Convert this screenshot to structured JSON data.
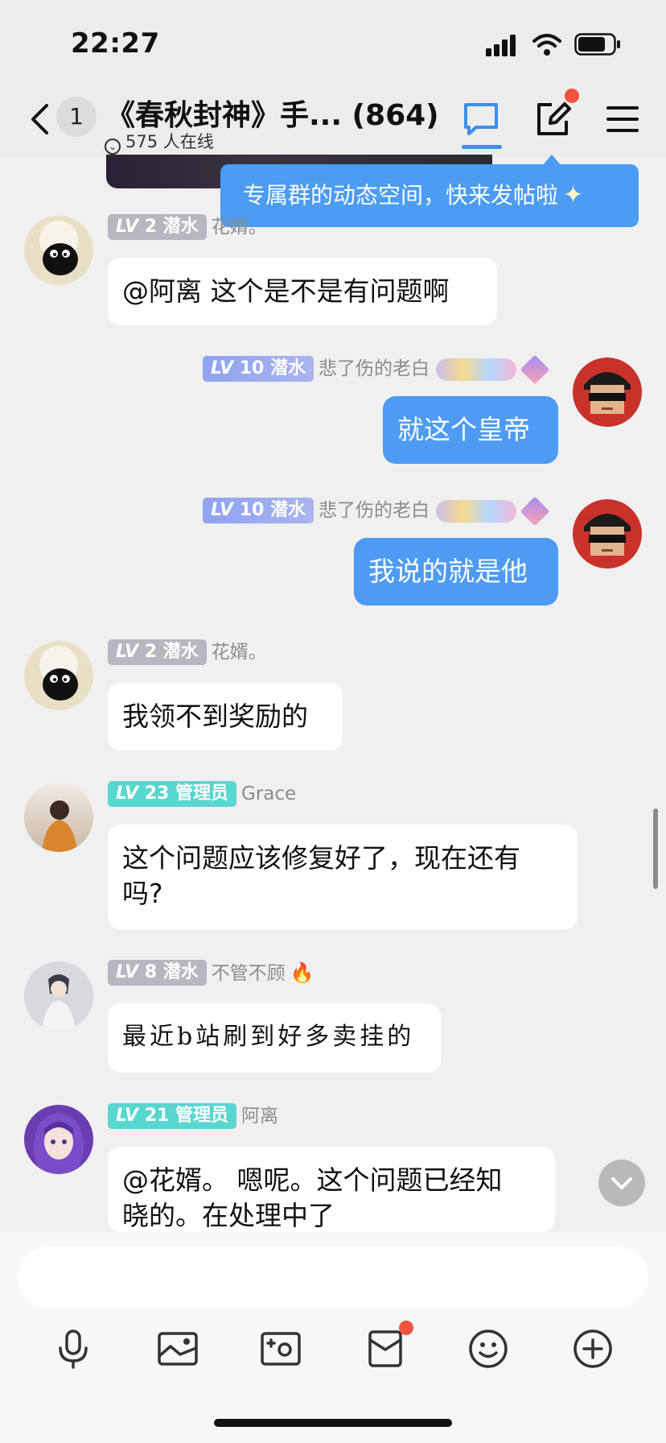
{
  "status": {
    "time": "22:27"
  },
  "header": {
    "unread_count": "1",
    "title": "《春秋封神》手... (864)",
    "online": "575 人在线"
  },
  "tooltip": {
    "text": "专属群的动态空间，快来发帖啦"
  },
  "messages": [
    {
      "side": "left",
      "level": "LV",
      "level_num": "2",
      "role": "潜水",
      "name": "花婿。",
      "text": "@阿离 这个是不是有问题啊",
      "avatar": "sheep-avatar"
    },
    {
      "side": "right",
      "level": "LV",
      "level_num": "10",
      "role": "潜水",
      "name": "悲了伤的老白",
      "text": "就这个皇帝",
      "avatar": "sunglasses-avatar"
    },
    {
      "side": "right",
      "level": "LV",
      "level_num": "10",
      "role": "潜水",
      "name": "悲了伤的老白",
      "text": "我说的就是他",
      "avatar": "sunglasses-avatar"
    },
    {
      "side": "left",
      "level": "LV",
      "level_num": "2",
      "role": "潜水",
      "name": "花婿。",
      "text": "我领不到奖励的",
      "avatar": "sheep-avatar"
    },
    {
      "side": "left",
      "level": "LV",
      "level_num": "23",
      "role": "管理员",
      "name": "Grace",
      "text_lines": [
        "这个问题应该修复好了，现在还有",
        "吗?"
      ],
      "avatar": "photo-avatar"
    },
    {
      "side": "left",
      "level": "LV",
      "level_num": "8",
      "role": "潜水",
      "name": "不管不顾",
      "text": "最近b站刷到好多卖挂的",
      "avatar": "swordsman-avatar"
    },
    {
      "side": "left",
      "level": "LV",
      "level_num": "21",
      "role": "管理员",
      "name": "阿离",
      "text_lines": [
        "@花婿。 嗯呢。这个问题已经知",
        "晓的。在处理中了"
      ],
      "avatar": "anime-girl-avatar"
    }
  ],
  "colors": {
    "accent": "#4d9bf3",
    "admin_tag": "#59d6cf",
    "member_tag": "#b7b7c2",
    "notify": "#f0543f"
  },
  "toolbar": {
    "icons": [
      "microphone-icon",
      "image-icon",
      "camera-icon",
      "red-packet-icon",
      "emoji-icon",
      "plus-icon"
    ]
  }
}
